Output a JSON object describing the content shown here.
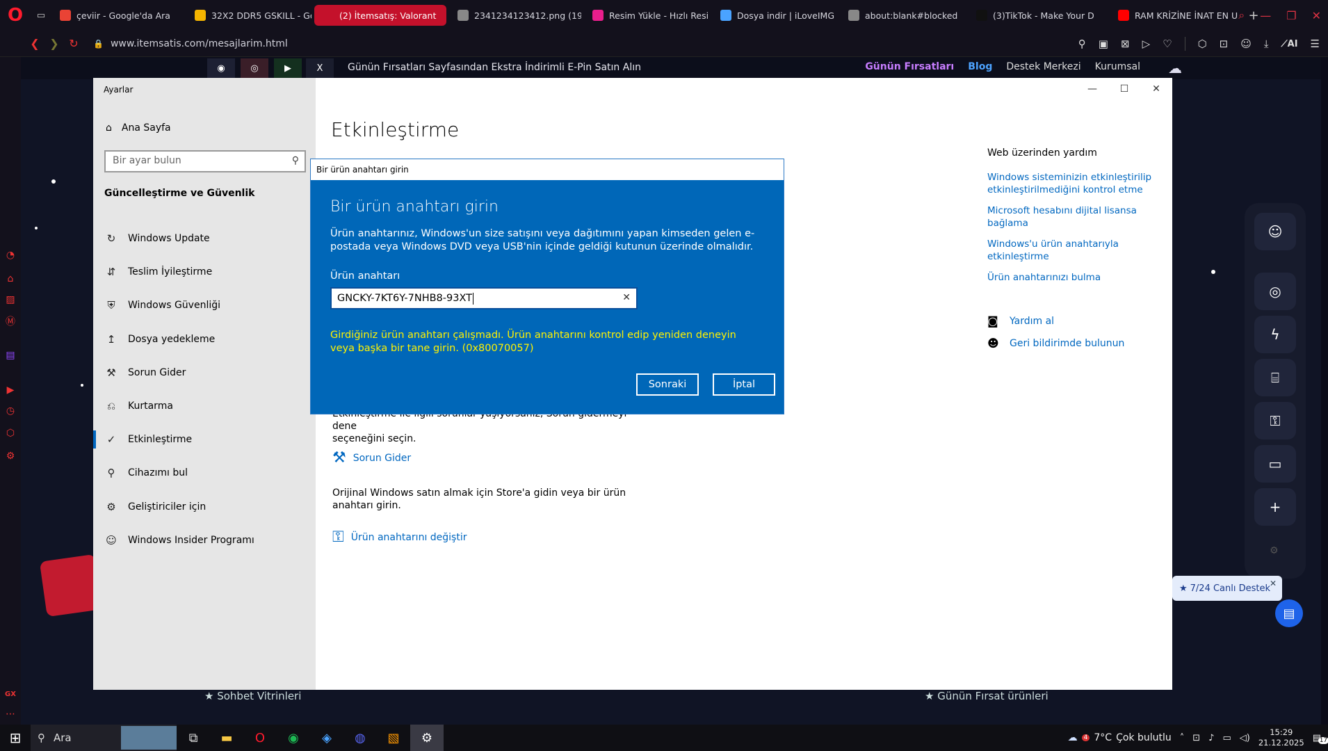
{
  "browser": {
    "tabs": [
      {
        "label": "çeviir - Google'da Ara",
        "active": false,
        "color": "#ea4335"
      },
      {
        "label": "32X2 DDR5 GSKILL - Go",
        "active": false,
        "color": "#f4b400"
      },
      {
        "label": "(2) İtemsatış: Valorant",
        "active": true,
        "color": "#c4112b"
      },
      {
        "label": "2341234123412.png (19",
        "active": false,
        "color": "#888888"
      },
      {
        "label": "Resim Yükle - Hızlı Resi",
        "active": false,
        "color": "#e91e8c"
      },
      {
        "label": "Dosya indir | iLoveIMG",
        "active": false,
        "color": "#4aa3ff"
      },
      {
        "label": "about:blank#blocked",
        "active": false,
        "color": "#888888"
      },
      {
        "label": "(3)TikTok - Make Your D",
        "active": false,
        "color": "#111111"
      },
      {
        "label": "RAM KRİZİNE İNAT EN U",
        "active": false,
        "color": "#ff0000"
      }
    ],
    "url": "www.itemsatis.com/mesajlarim.html",
    "ai_label": "AI"
  },
  "site": {
    "promo": "Günün Fırsatları Sayfasından Ekstra İndirimli E-Pin Satın Alın",
    "nav": {
      "deals": "Günün Fırsatları",
      "blog": "Blog",
      "support": "Destek Merkezi",
      "corporate": "Kurumsal"
    },
    "bottom_left": "Sohbet Vitrinleri",
    "bottom_right": "Günün Fırsat ürünleri",
    "live_support": "7/24 Canlı Destek"
  },
  "settings": {
    "window_title": "Ayarlar",
    "home": "Ana Sayfa",
    "search_placeholder": "Bir ayar bulun",
    "section": "Güncelleştirme ve Güvenlik",
    "items": [
      {
        "label": "Windows Update",
        "icon": "↻"
      },
      {
        "label": "Teslim İyileştirme",
        "icon": "⇵"
      },
      {
        "label": "Windows Güvenliği",
        "icon": "⛨"
      },
      {
        "label": "Dosya yedekleme",
        "icon": "↥"
      },
      {
        "label": "Sorun Gider",
        "icon": "⚒"
      },
      {
        "label": "Kurtarma",
        "icon": "⎌"
      },
      {
        "label": "Etkinleştirme",
        "icon": "✓"
      },
      {
        "label": "Cihazımı bul",
        "icon": "⚲"
      },
      {
        "label": "Geliştiriciler için",
        "icon": "⚙"
      },
      {
        "label": "Windows Insider Programı",
        "icon": "☺"
      }
    ],
    "page_title": "Etkinleştirme",
    "help_heading": "Web üzerinden yardım",
    "help_links": [
      "Windows sisteminizin etkinleştirilip etkinleştirilmediğini kontrol etme",
      "Microsoft hesabını dijital lisansa bağlama",
      "Windows'u ürün anahtarıyla etkinleştirme",
      "Ürün anahtarınızı bulma"
    ],
    "get_help": "Yardım al",
    "feedback": "Geri bildirimde bulunun",
    "troubleshoot_text": "Etkinleştirme ile ilgili sorunlar yaşıyorsanız, Sorun gidermeyi deneseçeneğini seçin.",
    "troubleshoot_text_line1": "Etkinleştirme ile ilgili sorunlar yaşıyorsanız, Sorun gidermeyi dene",
    "troubleshoot_text_line2": "seçeneğini seçin.",
    "troubleshoot_link": "Sorun Gider",
    "store_text": "Orijinal Windows satın almak için Store'a gidin veya bir ürün anahtarı girin.",
    "change_key_link": "Ürün anahtarını değiştir"
  },
  "dialog": {
    "titlebar": "Bir ürün anahtarı girin",
    "heading": "Bir ürün anahtarı girin",
    "description": "Ürün anahtarınız, Windows'un size satışını veya dağıtımını yapan kimseden gelen e-postada veya Windows DVD veya USB'nin içinde geldiği kutunun üzerinde olmalıdır.",
    "field_label": "Ürün anahtarı",
    "key_value": "GNCKY-7KT6Y-7NHB8-93XT",
    "error": "Girdiğiniz ürün anahtarı çalışmadı. Ürün anahtarını kontrol edip yeniden deneyin veya başka bir tane girin. (0x80070057)",
    "next_label": "Sonraki",
    "cancel_label": "İptal"
  },
  "taskbar": {
    "search_label": "Ara",
    "weather_temp": "7°C",
    "weather_text": "Çok bulutlu",
    "weather_badge": "4",
    "time": "15:29",
    "date": "21.12.2025",
    "notif_count": "17"
  },
  "colors": {
    "dialog_blue": "#0067b8",
    "error_yellow": "#fff200",
    "link_blue": "#0067c0",
    "opera_red": "#ff1b2d"
  }
}
